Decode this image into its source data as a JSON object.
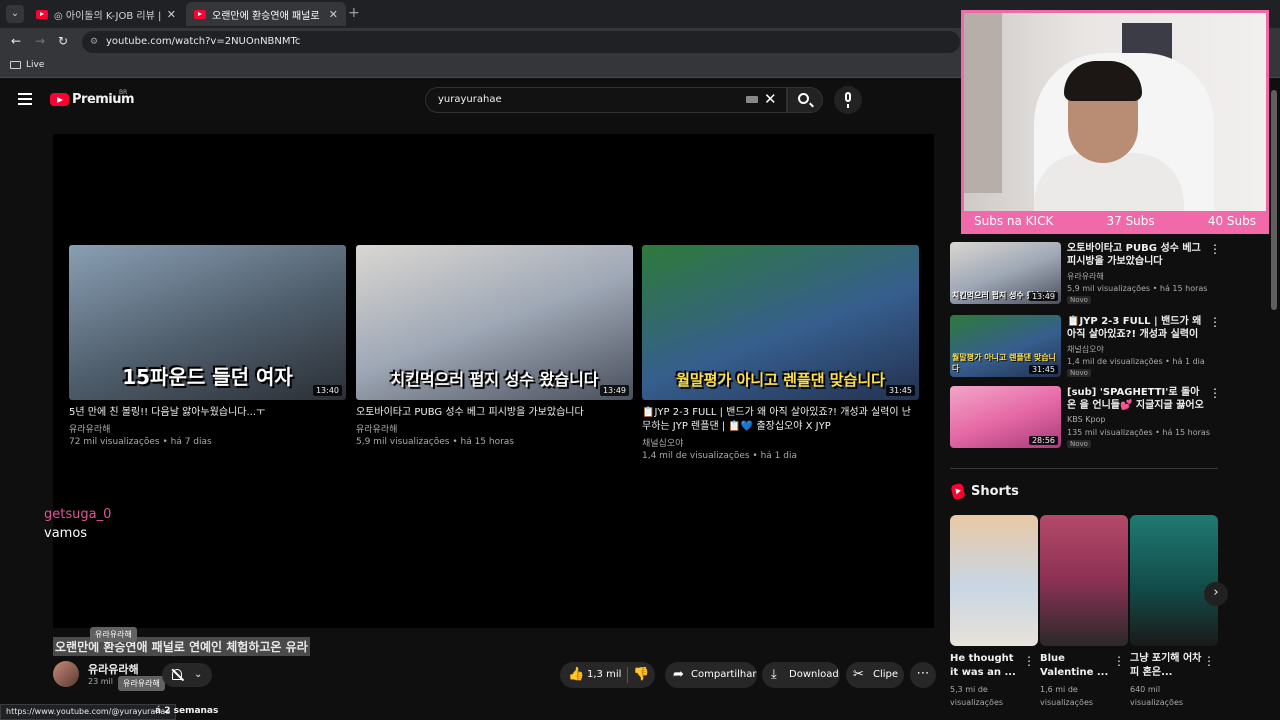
{
  "browser": {
    "tabs": [
      {
        "title": "◎ 아이돌의 K-JOB 리뷰 | work",
        "active": false
      },
      {
        "title": "오랜만에 환승연애 패널로 연예",
        "active": true
      }
    ],
    "url": "youtube.com/watch?v=2NUOnNBNMTc",
    "bookmark": "Live"
  },
  "header": {
    "logo": "Premium",
    "country": "BR",
    "search_value": "yurayurahae"
  },
  "endcards": [
    {
      "thumb_text": "15파운드 들던 여자",
      "duration": "13:40",
      "title": "5년 만에 친 볼링!! 다음날 앓아누웠습니다...ㅜ",
      "channel": "유라유라해",
      "meta": "72 mil visualizações • há 7 dias",
      "bg": "linear-gradient(160deg,#8a9fb4,#4e5d6b 55%,#2b2f36)"
    },
    {
      "thumb_text": "치킨먹으러 펍지 성수 왔습니다",
      "duration": "13:49",
      "title": "오토바이타고 PUBG 성수 베그 피시방을 가보았습니다",
      "channel": "유라유라해",
      "meta": "5,9 mil visualizações • há 15 horas",
      "bg": "linear-gradient(160deg,#dad7d2,#9fa8b6 50%,#4a4f5c)"
    },
    {
      "thumb_text": "월말평가 아니고 렌플댄 맞습니다",
      "duration": "31:45",
      "title": "📋JYP 2-3 FULL | 밴드가 왜 아직 살아있죠?! 개성과 실력이 난무하는 JYP 렌플댄 | 📋💙 출장십오야 X JYP",
      "channel": "채널십오야",
      "meta": "1,4 mil de visualizações • há 1 dia",
      "bg": "linear-gradient(160deg,#2e7a3a,#365e8e 55%,#23314f)"
    }
  ],
  "chat": {
    "user": "getsuga_0",
    "message": "vamos"
  },
  "video": {
    "title": "오랜만에 환승연애 패널로 연예인 체험하고온 유라",
    "channel": "유라유라해",
    "subs": "23 mil",
    "tooltip": "유라유라해",
    "likes": "1,3 mil",
    "share": "Compartilhar",
    "download": "Download",
    "clip": "Clipe",
    "desc_time": "á 2 semanas",
    "status_url": "https://www.youtube.com/@yurayurahae"
  },
  "recommendations": [
    {
      "title": "오토바이타고 PUBG 성수 베그 피시방을 가보았습니다",
      "channel": "유라유라해",
      "meta": "5,9 mil visualizações • há 15 horas",
      "badge": "Novo",
      "duration": "13:49",
      "thumb_text": "치킨먹으러 펍지 성수 왔습니다",
      "bg": "linear-gradient(160deg,#dad7d2,#9fa8b6 50%,#4a4f5c)"
    },
    {
      "title": "📋JYP 2-3 FULL | 밴드가 왜 아직 살아있죠?! 개성과 실력이 난무...",
      "channel": "채널십오야",
      "meta": "1,4 mil de visualizações • há 1 dia",
      "badge": "Novo",
      "duration": "31:45",
      "thumb_text": "월말평가 아니고 렌플댄 맞습니다",
      "bg": "linear-gradient(160deg,#2e7a3a,#365e8e 55%,#23314f)"
    },
    {
      "title": "[sub] 'SPAGHETTI'로 돌아온 을 언니들💕 지글지글 끓어오르...",
      "channel": "KBS Kpop",
      "meta": "135 mil visualizações • há 15 horas",
      "badge": "Novo",
      "duration": "28:56",
      "thumb_text": "",
      "bg": "linear-gradient(160deg,#f2a6c9,#e66aa6 50%,#a83b7a)"
    }
  ],
  "shorts": {
    "label": "Shorts",
    "items": [
      {
        "title": "He thought it was an ...",
        "meta1": "5,3 mi de",
        "meta2": "visualizações",
        "bg": "linear-gradient(180deg,#e8c9a6,#c9d6e4 55%,#e8e2da)"
      },
      {
        "title": "Blue Valentine ...",
        "meta1": "1,6 mi de",
        "meta2": "visualizações",
        "bg": "linear-gradient(180deg,#b5496a,#8c3154 50%,#2a2a2a)"
      },
      {
        "title": "그냥 포기해 어차피 혼은...",
        "meta1": "640 mil",
        "meta2": "visualizações",
        "bg": "linear-gradient(180deg,#1f7a72,#124c4a 55%,#1a1a1a)"
      }
    ]
  },
  "webcam": {
    "subs_label": "Subs na KICK",
    "subs_a": "37 Subs",
    "subs_b": "40 Subs"
  }
}
